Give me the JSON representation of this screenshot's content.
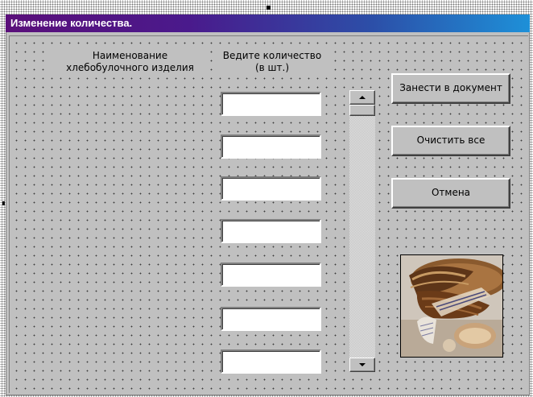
{
  "window": {
    "title": "Изменение количества."
  },
  "labels": {
    "product_name": "Наименование\nхлебобулочного изделия",
    "quantity": "Ведите количество\n(в шт.)"
  },
  "quantity_fields": [
    {
      "value": ""
    },
    {
      "value": ""
    },
    {
      "value": ""
    },
    {
      "value": ""
    },
    {
      "value": ""
    },
    {
      "value": ""
    },
    {
      "value": ""
    }
  ],
  "buttons": {
    "submit": "Занести в документ",
    "clear": "Очистить все",
    "cancel": "Отмена"
  },
  "icons": {
    "scroll_up": "arrow-up-icon",
    "scroll_down": "arrow-down-icon",
    "bread_image": "bread-basket-image"
  },
  "colors": {
    "title_gradient_start": "#5a0f7a",
    "title_gradient_end": "#1e90d8",
    "form_background": "#c0c0c0"
  }
}
